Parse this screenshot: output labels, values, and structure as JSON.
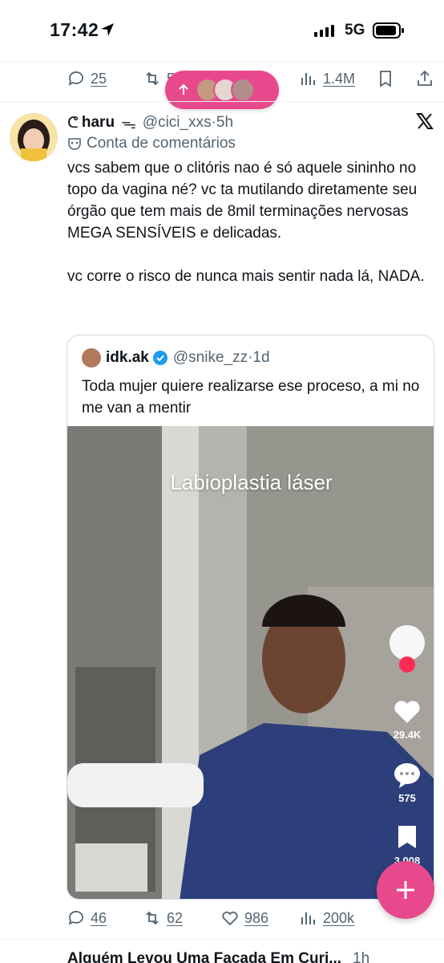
{
  "status_bar": {
    "time": "17:42",
    "network": "5G"
  },
  "prev_tweet_actions": {
    "replies": "25",
    "retweets": "5",
    "views": "1.4M"
  },
  "tweet": {
    "display_name": "haru",
    "name_prefix": "ᕦ",
    "name_suffix": "ᯓ",
    "handle": "@cici_xxs",
    "time": "5h",
    "label": "Conta de comentários",
    "text": "vcs sabem que o clitóris nao é só aquele sininho no topo da vagina né? vc ta mutilando diretamente seu órgão que tem mais de 8mil terminações nervosas MEGA SENSÍVEIS e delicadas.\n\nvc corre o risco de nunca mais sentir nada lá, NADA.",
    "quote": {
      "display_name": "idk.ak",
      "handle": "@snike_zz",
      "time": "1d",
      "text": "Toda mujer quiere realizarse ese proceso, a mi no me van a mentir",
      "video": {
        "title": "Labioplastia láser",
        "likes": "29.4K",
        "comments": "575",
        "saves": "3,008"
      }
    },
    "actions": {
      "replies": "46",
      "retweets": "62",
      "likes": "986",
      "views": "200k"
    }
  },
  "next_tweet": {
    "title": "Alguém Levou Uma Facada Em Curi...",
    "time": "1h"
  },
  "colors": {
    "accent": "#e8498c",
    "muted": "#536471",
    "verified": "#1d9bf0"
  }
}
